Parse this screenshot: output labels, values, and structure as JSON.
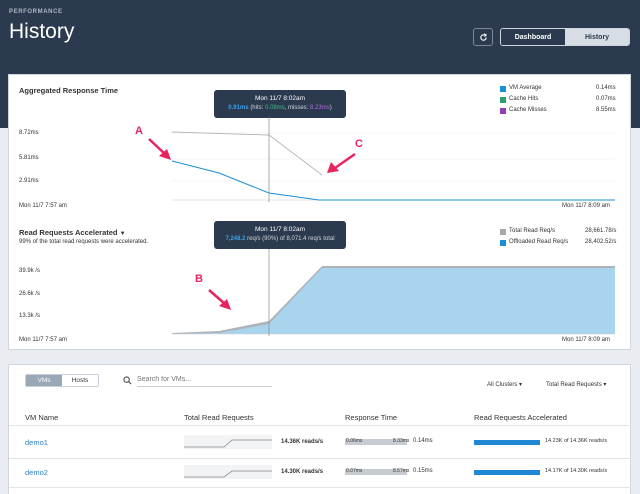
{
  "header": {
    "eyebrow": "PERFORMANCE",
    "title": "History",
    "refresh_icon": "refresh-icon",
    "tabs": [
      {
        "label": "Dashboard",
        "active": true
      },
      {
        "label": "History",
        "active": false
      }
    ]
  },
  "response_chart": {
    "title": "Aggregated Response Time",
    "tooltip": {
      "time": "Mon 11/7 8:02am",
      "value": "0.91ms",
      "hits_label": "(hits: ",
      "hits": "0.08ms",
      "misses_label": ", misses: ",
      "misses": "8.23ms",
      "close": ")"
    },
    "legend": [
      {
        "name": "VM Average",
        "value": "0.14ms",
        "color": "#1a8fd6"
      },
      {
        "name": "Cache Hits",
        "value": "0.07ms",
        "color": "#2e9e6b"
      },
      {
        "name": "Cache Misses",
        "value": "8.55ms",
        "color": "#8d3fb4"
      }
    ],
    "y_ticks": [
      "8.72ms",
      "5.81ms",
      "2.91ms"
    ],
    "x_start": "Mon 11/7 7:57 am",
    "x_end": "Mon 11/7 8:09 am",
    "annotations": [
      "A",
      "C"
    ]
  },
  "read_chart": {
    "title": "Read Requests Accelerated",
    "subtitle": "99% of the total read requests were accelerated.",
    "tooltip": {
      "time": "Mon 11/7 8:02am",
      "value": "7,248.2",
      "text": " req/s (90%) of 8,071.4 req/s total"
    },
    "legend": [
      {
        "name": "Total Read Req/s",
        "value": "28,661.78/s",
        "color": "#a7a9ac"
      },
      {
        "name": "Offloaded Read Req/s",
        "value": "28,402.52/s",
        "color": "#1a8fd6"
      }
    ],
    "y_ticks": [
      "39.9k /s",
      "26.6k /s",
      "13.3k /s"
    ],
    "x_start": "Mon 11/7 7:57 am",
    "x_end": "Mon 11/7 8:09 am",
    "annotations": [
      "B"
    ]
  },
  "table": {
    "toggle": [
      {
        "label": "VMs",
        "active": true
      },
      {
        "label": "Hosts",
        "active": false
      }
    ],
    "search_placeholder": "Search for VMs...",
    "filters": [
      "All Clusters",
      "Total Read Requests"
    ],
    "columns": [
      "VM Name",
      "Total Read Requests",
      "Response Time",
      "Read Requests Accelerated"
    ],
    "rows": [
      {
        "name": "demo1",
        "reads": "14.36K reads/s",
        "rt_left": "0.06ms",
        "rt_right": "8.33ms",
        "rt_avg": "0.14ms",
        "acc": "14.23K of 14.36K reads/s",
        "acc_fraction": 0.99
      },
      {
        "name": "demo2",
        "reads": "14.30K reads/s",
        "rt_left": "0.07ms",
        "rt_right": "8.57ms",
        "rt_avg": "0.15ms",
        "acc": "14.17K of 14.30K reads/s",
        "acc_fraction": 0.99
      }
    ]
  }
}
